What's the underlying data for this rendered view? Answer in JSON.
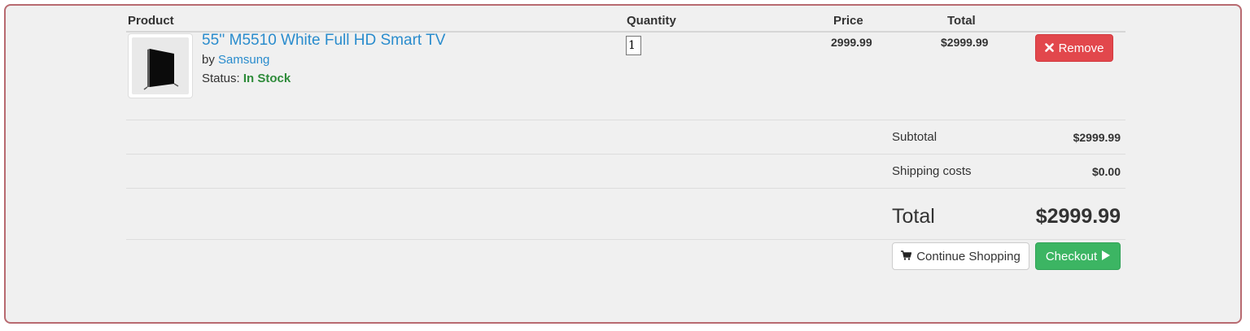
{
  "colors": {
    "link": "#2a8ccd",
    "in_stock": "#2e8b3a",
    "remove_button": "#e2474c",
    "checkout_button": "#3cb563",
    "frame_border": "#b86a70",
    "background": "#f0f0f0"
  },
  "table": {
    "headers": {
      "product": "Product",
      "quantity": "Quantity",
      "price": "Price",
      "total": "Total"
    }
  },
  "items": [
    {
      "title": "55'' M5510 White Full HD Smart TV",
      "by_prefix": "by",
      "brand": "Samsung",
      "status_label": "Status:",
      "status_value": "In Stock",
      "quantity": "1",
      "price": "2999.99",
      "total": "$2999.99",
      "remove_label": "Remove",
      "remove_icon": "close-icon",
      "thumbnail_icon": "tv-icon"
    }
  ],
  "summary": {
    "subtotal_label": "Subtotal",
    "subtotal_value": "$2999.99",
    "shipping_label": "Shipping costs",
    "shipping_value": "$0.00",
    "total_label": "Total",
    "total_value": "$2999.99"
  },
  "actions": {
    "continue_label": "Continue Shopping",
    "continue_icon": "cart-icon",
    "checkout_label": "Checkout",
    "checkout_icon": "play-icon"
  }
}
